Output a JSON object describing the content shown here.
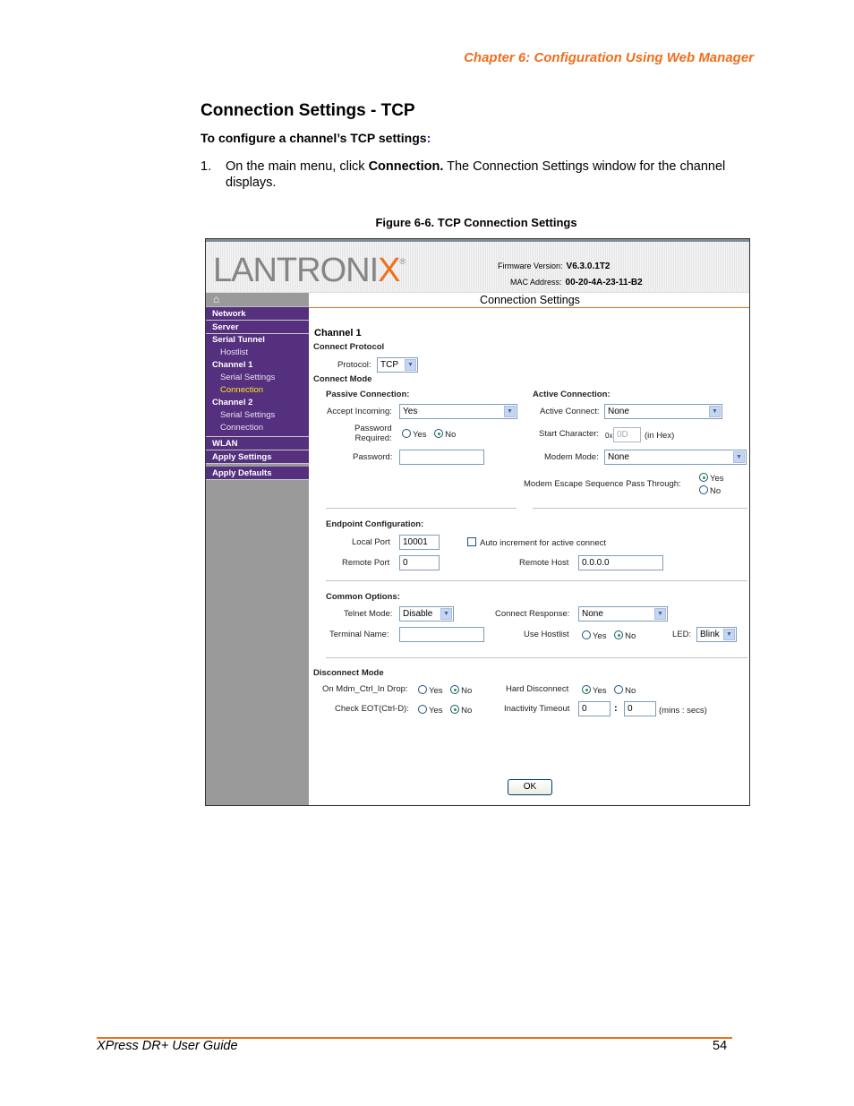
{
  "doc": {
    "chapter_header": "Chapter 6: Configuration Using Web Manager",
    "section_title": "Connection Settings - TCP",
    "subheading": "To configure a channel’s TCP settings",
    "subheading_colon": ":",
    "step_number": "1.",
    "step_text_a": "On the main menu, click ",
    "step_text_bold": "Connection.",
    "step_text_b": " The Connection Settings window for the channel displays.",
    "figure_caption": "Figure 6-6. TCP Connection Settings",
    "footer_title": "XPress DR+ User Guide",
    "page_number": "54"
  },
  "colors": {
    "accent_orange": "#ee6f1c",
    "nav_purple": "#55307f",
    "nav_active": "#ffe21f",
    "sidebar_gray": "#9a9a9a"
  },
  "webui": {
    "logo_text": "LANTRONI",
    "logo_x": "X",
    "logo_reg": "®",
    "firmware_label": "Firmware Version:",
    "firmware_value": "V6.3.0.1T2",
    "mac_label": "MAC Address:",
    "mac_value": "00-20-4A-23-11-B2",
    "home_icon": "⌂",
    "page_title": "Connection Settings",
    "nav": {
      "network": "Network",
      "server": "Server",
      "serial_tunnel": "Serial Tunnel",
      "hostlist": "Hostlist",
      "channel1": "Channel 1",
      "ch1_serial": "Serial Settings",
      "ch1_connection": "Connection",
      "channel2": "Channel 2",
      "ch2_serial": "Serial Settings",
      "ch2_connection": "Connection",
      "wlan": "WLAN",
      "apply_settings": "Apply Settings",
      "apply_defaults": "Apply Defaults"
    },
    "form": {
      "channel": "Channel 1",
      "connect_protocol": "Connect Protocol",
      "protocol_label": "Protocol:",
      "protocol_value": "TCP",
      "connect_mode": "Connect Mode",
      "passive_heading": "Passive Connection:",
      "accept_incoming_label": "Accept Incoming:",
      "accept_incoming_value": "Yes",
      "password_required_label_1": "Password",
      "password_required_label_2": "Required:",
      "yes": "Yes",
      "no": "No",
      "password_label": "Password:",
      "password_value": "",
      "active_heading": "Active Connection:",
      "active_connect_label": "Active Connect:",
      "active_connect_value": "None",
      "start_char_label": "Start Character:",
      "start_char_prefix": "0x",
      "start_char_value": "0D",
      "start_char_suffix": "(in Hex)",
      "modem_mode_label": "Modem Mode:",
      "modem_mode_value": "None",
      "modem_escape_label": "Modem Escape Sequence Pass Through:",
      "endpoint_heading": "Endpoint Configuration:",
      "local_port_label": "Local Port",
      "local_port_value": "10001",
      "auto_increment_label": "Auto increment for active connect",
      "remote_port_label": "Remote Port",
      "remote_port_value": "0",
      "remote_host_label": "Remote Host",
      "remote_host_value": "0.0.0.0",
      "common_heading": "Common Options:",
      "telnet_mode_label": "Telnet Mode:",
      "telnet_mode_value": "Disable",
      "connect_response_label": "Connect Response:",
      "connect_response_value": "None",
      "terminal_name_label": "Terminal Name:",
      "terminal_name_value": "",
      "use_hostlist_label": "Use Hostlist",
      "led_label": "LED:",
      "led_value": "Blink",
      "disconnect_heading": "Disconnect Mode",
      "mdm_drop_label": "On Mdm_Ctrl_In Drop:",
      "hard_disconnect_label": "Hard Disconnect",
      "check_eot_label": "Check EOT(Ctrl-D):",
      "inactivity_label": "Inactivity Timeout",
      "inactivity_mins": "0",
      "inactivity_sep": ":",
      "inactivity_secs": "0",
      "inactivity_suffix": "(mins : secs)",
      "ok_label": "OK"
    }
  }
}
